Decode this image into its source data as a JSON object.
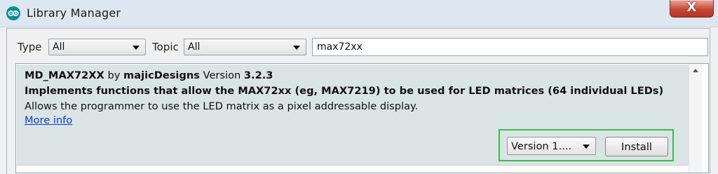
{
  "window": {
    "title": "Library Manager",
    "close_label": "X"
  },
  "filters": {
    "type_label": "Type",
    "type_value": "All",
    "topic_label": "Topic",
    "topic_value": "All",
    "search_value": "max72xx"
  },
  "library": {
    "name": "MD_MAX72XX",
    "by": "by",
    "author": "majicDesigns",
    "version_label": "Version",
    "version": "3.2.3",
    "summary": "Implements functions that allow the MAX72xx (eg, MAX7219) to be used for LED matrices (64 individual LEDs)",
    "description": "Allows the programmer to use the LED matrix as a pixel addressable display.",
    "more_info": "More info",
    "version_select_value": "Version 1....",
    "install_label": "Install"
  },
  "colors": {
    "highlight_border": "#33c04a",
    "link": "#0a3ec9",
    "selected_row_bg": "#dbe4e4"
  }
}
